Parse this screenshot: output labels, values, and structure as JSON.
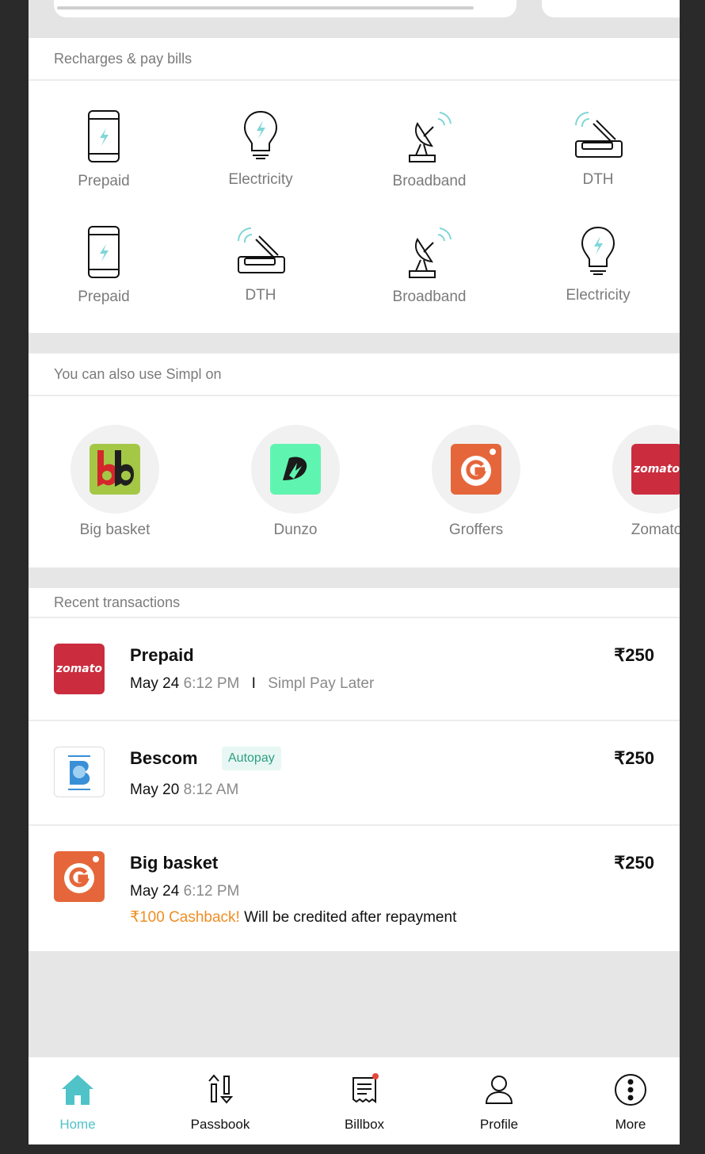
{
  "bills_section": {
    "title": "Recharges & pay bills",
    "items": [
      {
        "label": "Prepaid",
        "icon": "prepaid-phone-icon"
      },
      {
        "label": "Electricity",
        "icon": "electricity-bulb-icon"
      },
      {
        "label": "Broadband",
        "icon": "broadband-dish-icon"
      },
      {
        "label": "DTH",
        "icon": "dth-router-icon"
      },
      {
        "label": "Prepaid",
        "icon": "prepaid-phone-icon"
      },
      {
        "label": "DTH",
        "icon": "dth-router-icon"
      },
      {
        "label": "Broadband",
        "icon": "broadband-dish-icon"
      },
      {
        "label": "Electricity",
        "icon": "electricity-bulb-icon"
      }
    ]
  },
  "merchants_section": {
    "title": "You can also use Simpl on",
    "items": [
      {
        "label": "Big basket",
        "logo": "bigbasket-logo"
      },
      {
        "label": "Dunzo",
        "logo": "dunzo-logo"
      },
      {
        "label": "Groffers",
        "logo": "grofers-logo"
      },
      {
        "label": "Zomato",
        "logo": "zomato-logo",
        "logo_text": "zomato"
      }
    ]
  },
  "recent_section": {
    "title": "Recent transactions",
    "transactions": [
      {
        "title": "Prepaid",
        "amount": "₹250",
        "date": "May 24",
        "time": "6:12 PM",
        "separator": "I",
        "method": "Simpl Pay Later",
        "logo": "zomato-logo",
        "logo_text": "zomato"
      },
      {
        "title": "Bescom",
        "badge": "Autopay",
        "amount": "₹250",
        "date": "May 20",
        "time": "8:12 AM",
        "logo": "bescom-logo"
      },
      {
        "title": "Big basket",
        "amount": "₹250",
        "date": "May 24",
        "time": "6:12 PM",
        "cashback_highlight": "₹100 Cashback!",
        "cashback_text": " Will be credited after repayment",
        "logo": "grofers-logo"
      }
    ]
  },
  "nav": {
    "items": [
      {
        "label": "Home",
        "icon": "home-icon",
        "active": true
      },
      {
        "label": "Passbook",
        "icon": "passbook-arrows-icon"
      },
      {
        "label": "Billbox",
        "icon": "billbox-receipt-icon",
        "notification": true
      },
      {
        "label": "Profile",
        "icon": "profile-person-icon"
      },
      {
        "label": "More",
        "icon": "more-dots-icon"
      }
    ]
  },
  "colors": {
    "accent": "#4fc3c7",
    "cashback": "#ef8d23",
    "badge_bg": "#e8f7f3",
    "badge_text": "#2e9d83",
    "zomato": "#cb2d3e",
    "grofers": "#e5663a",
    "dunzo": "#5ff5b0",
    "bigbasket": "#a4c846"
  }
}
